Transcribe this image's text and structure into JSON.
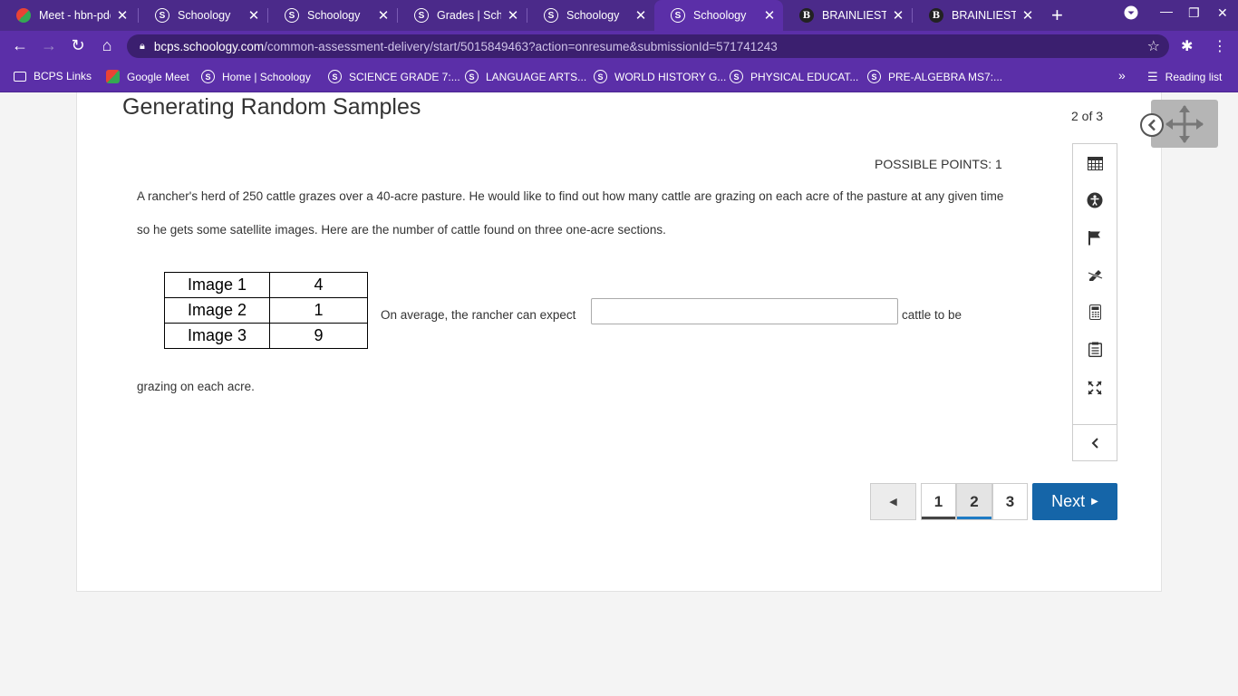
{
  "browser": {
    "tabs": [
      {
        "title": "Meet - hbn-pdq",
        "icon": "meet-icon"
      },
      {
        "title": "Schoology",
        "icon": "schoology-icon"
      },
      {
        "title": "Schoology",
        "icon": "schoology-icon"
      },
      {
        "title": "Grades | Schoo",
        "icon": "schoology-icon"
      },
      {
        "title": "Schoology",
        "icon": "schoology-icon"
      },
      {
        "title": "Schoology",
        "icon": "schoology-icon",
        "active": true
      },
      {
        "title": "BRAINLIEST IF",
        "icon": "brainly-icon"
      },
      {
        "title": "BRAINLIEST IF",
        "icon": "brainly-icon"
      }
    ],
    "url_host": "bcps.schoology.com",
    "url_path": "/common-assessment-delivery/start/5015849463?action=onresume&submissionId=571741243",
    "bookmarks": [
      "BCPS Links",
      "Google Meet",
      "Home | Schoology",
      "SCIENCE GRADE 7:...",
      "LANGUAGE ARTS...",
      "WORLD HISTORY G...",
      "PHYSICAL EDUCAT...",
      "PRE-ALGEBRA MS7:..."
    ],
    "reading_list": "Reading list",
    "accent_color": "#5b2fa8"
  },
  "assessment": {
    "title": "Generating Random Samples",
    "counter": "2 of 3",
    "possible_points": "POSSIBLE POINTS: 1",
    "question_text": "A rancher's herd of 250 cattle grazes over a 40-acre pasture. He would like to find out how many cattle are grazing on each acre of the pasture at any given time so he gets some satellite images. Here are the number of cattle found on three one-acre sections.",
    "table": [
      {
        "label": "Image 1",
        "value": "4"
      },
      {
        "label": "Image 2",
        "value": "1"
      },
      {
        "label": "Image 3",
        "value": "9"
      }
    ],
    "prompt_before": "On average, the rancher can expect",
    "prompt_after": "cattle to be",
    "prompt_end": "grazing on each acre.",
    "answer_value": "",
    "pages": [
      "1",
      "2",
      "3"
    ],
    "current_page": "2",
    "next_label": "Next",
    "next_color": "#1565a8"
  }
}
